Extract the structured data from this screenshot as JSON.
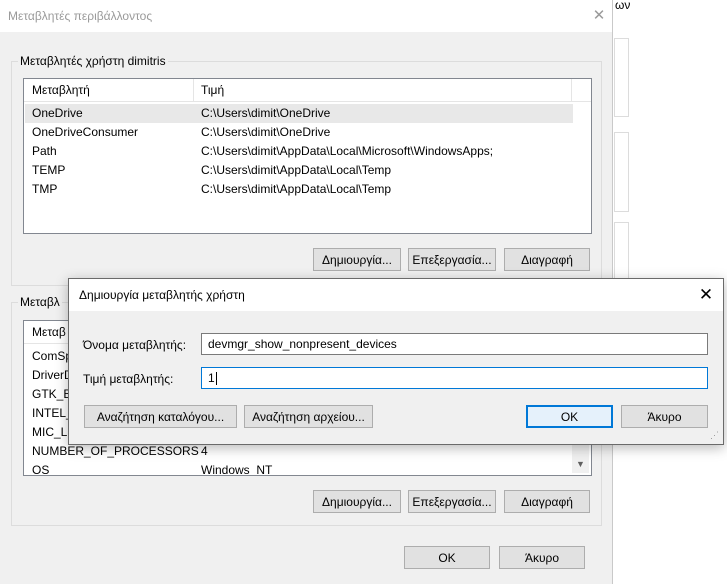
{
  "background_window": {
    "text_fragment": "ων"
  },
  "env_dialog": {
    "title": "Μεταβλητές περιβάλλοντος",
    "user_group": {
      "legend": "Μεταβλητές χρήστη dimitris",
      "columns": [
        "Μεταβλητή",
        "Τιμή"
      ],
      "rows": [
        {
          "name": "OneDrive",
          "value": "C:\\Users\\dimit\\OneDrive"
        },
        {
          "name": "OneDriveConsumer",
          "value": "C:\\Users\\dimit\\OneDrive"
        },
        {
          "name": "Path",
          "value": "C:\\Users\\dimit\\AppData\\Local\\Microsoft\\WindowsApps;"
        },
        {
          "name": "TEMP",
          "value": "C:\\Users\\dimit\\AppData\\Local\\Temp"
        },
        {
          "name": "TMP",
          "value": "C:\\Users\\dimit\\AppData\\Local\\Temp"
        }
      ],
      "selected_row": 0,
      "buttons": {
        "new": "Δημιουργία...",
        "edit": "Επεξεργασία...",
        "delete": "Διαγραφή"
      }
    },
    "system_group": {
      "legend": "Μεταβλ",
      "columns": [
        "Μεταβ"
      ],
      "rows": [
        {
          "name": "ComSp",
          "value": ""
        },
        {
          "name": "DriverD",
          "value": ""
        },
        {
          "name": "GTK_BA",
          "value": ""
        },
        {
          "name": "INTEL_I",
          "value": ""
        },
        {
          "name": "MIC_LD",
          "value": ""
        },
        {
          "name": "NUMBER_OF_PROCESSORS",
          "value": "4"
        },
        {
          "name": "OS",
          "value": "Windows_NT"
        }
      ],
      "buttons": {
        "new": "Δημιουργία...",
        "edit": "Επεξεργασία...",
        "delete": "Διαγραφή"
      }
    },
    "footer": {
      "ok": "OK",
      "cancel": "Άκυρο"
    }
  },
  "new_var_dialog": {
    "title": "Δημιουργία μεταβλητής χρήστη",
    "name_label": "Όνομα μεταβλητής:",
    "name_value": "devmgr_show_nonpresent_devices",
    "value_label": "Τιμή μεταβλητής:",
    "value_value": "1",
    "browse_dir": "Αναζήτηση καταλόγου...",
    "browse_file": "Αναζήτηση αρχείου...",
    "ok": "OK",
    "cancel": "Άκυρο",
    "accent_color": "#0078d7"
  }
}
